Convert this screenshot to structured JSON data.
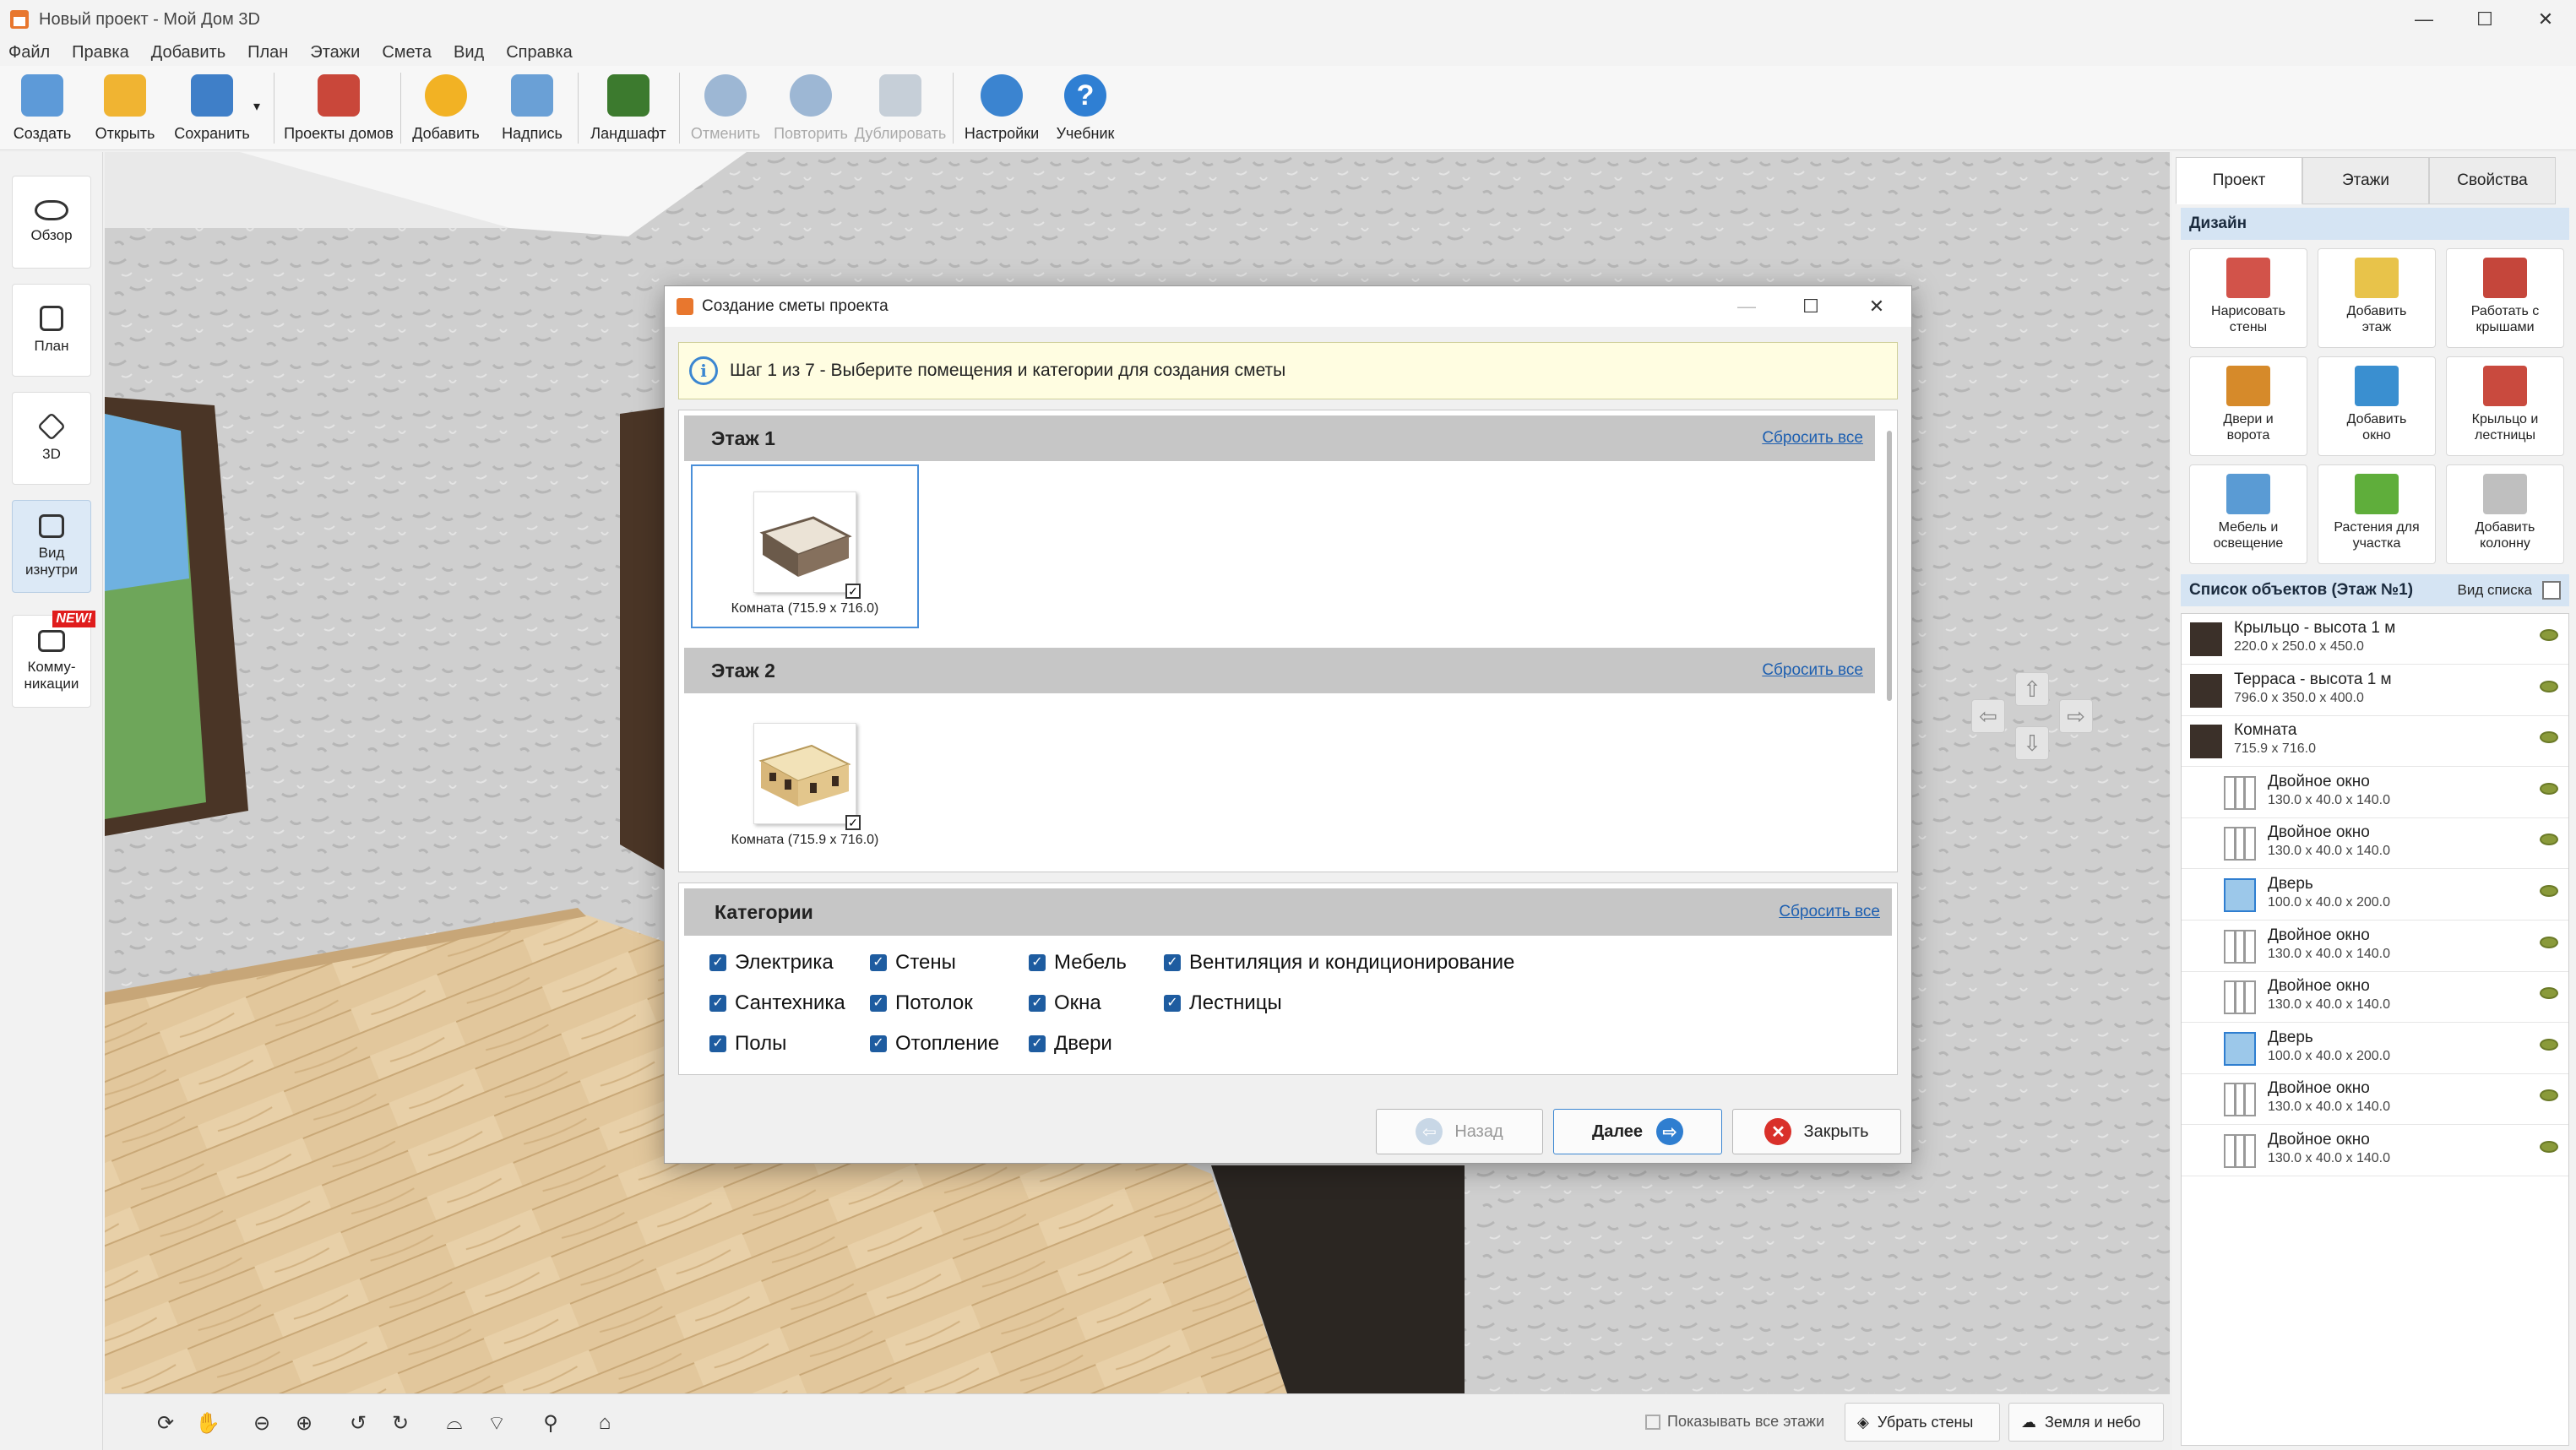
{
  "window": {
    "title": "Новый проект - Мой Дом 3D",
    "min": "—",
    "max": "☐",
    "close": "✕"
  },
  "menu": [
    "Файл",
    "Правка",
    "Добавить",
    "План",
    "Этажи",
    "Смета",
    "Вид",
    "Справка"
  ],
  "toolbar": [
    {
      "label": "Создать",
      "icon": "new-file-icon",
      "color": "#5d9ad8",
      "disabled": false
    },
    {
      "label": "Открыть",
      "icon": "folder-icon",
      "color": "#f0b432",
      "disabled": false
    },
    {
      "label": "Сохранить",
      "icon": "save-icon",
      "color": "#3f7fc8",
      "disabled": false
    },
    {
      "label": "Проекты домов",
      "icon": "house-icon",
      "color": "#c9473a",
      "disabled": false
    },
    {
      "label": "Добавить",
      "icon": "plus-icon",
      "color": "#f2b224",
      "disabled": false
    },
    {
      "label": "Надпись",
      "icon": "paint-icon",
      "color": "#6aa0d6",
      "disabled": false
    },
    {
      "label": "Ландшафт",
      "icon": "tree-icon",
      "color": "#3c7a2e",
      "disabled": false
    },
    {
      "label": "Отменить",
      "icon": "undo-icon",
      "color": "#9db7d4",
      "disabled": true
    },
    {
      "label": "Повторить",
      "icon": "redo-icon",
      "color": "#9db7d4",
      "disabled": true
    },
    {
      "label": "Дублировать",
      "icon": "duplicate-icon",
      "color": "#c6cfd8",
      "disabled": true
    },
    {
      "label": "Настройки",
      "icon": "gear-icon",
      "color": "#3b84d0",
      "disabled": false
    },
    {
      "label": "Учебник",
      "icon": "help-icon",
      "color": "#2f7fd3",
      "disabled": false
    }
  ],
  "left_panel": [
    {
      "label": "Обзор",
      "icon": "eye-icon",
      "active": false,
      "badge": ""
    },
    {
      "label": "План",
      "icon": "plan-icon",
      "active": false,
      "badge": ""
    },
    {
      "label": "3D",
      "icon": "cube-icon",
      "active": false,
      "badge": ""
    },
    {
      "label": "Вид изнутри",
      "icon": "inside-view-icon",
      "active": true,
      "badge": ""
    },
    {
      "label": "Комму-никации",
      "icon": "pipes-icon",
      "active": false,
      "badge": "NEW!"
    }
  ],
  "dialog": {
    "title": "Создание сметы проекта",
    "info": "Шаг 1 из 7 - Выберите помещения и категории для создания сметы",
    "floors": [
      {
        "name": "Этаж 1",
        "reset": "Сбросить все",
        "rooms": [
          {
            "label": "Комната (715.9 x 716.0)",
            "selected": true,
            "checked": "✓"
          }
        ]
      },
      {
        "name": "Этаж 2",
        "reset": "Сбросить все",
        "rooms": [
          {
            "label": "Комната (715.9 x 716.0)",
            "selected": false,
            "checked": "✓"
          }
        ]
      }
    ],
    "categories_title": "Категории",
    "categories_reset": "Сбросить все",
    "categories": [
      [
        "Электрика",
        "Сантехника",
        "Полы"
      ],
      [
        "Стены",
        "Потолок",
        "Отопление"
      ],
      [
        "Мебель",
        "Окна",
        "Двери"
      ],
      [
        "Вентиляция и кондиционирование",
        "Лестницы"
      ]
    ],
    "buttons": {
      "back": "Назад",
      "next": "Далее",
      "close": "Закрыть"
    }
  },
  "right_panel": {
    "tabs": [
      "Проект",
      "Этажи",
      "Свойства"
    ],
    "design_title": "Дизайн",
    "design_buttons": [
      {
        "label": "Нарисовать стены",
        "icon": "brick-wall-icon",
        "color": "#d2534a"
      },
      {
        "label": "Добавить этаж",
        "icon": "add-floor-icon",
        "color": "#e8c34a"
      },
      {
        "label": "Работать с крышами",
        "icon": "roof-icon",
        "color": "#c5463b"
      },
      {
        "label": "Двери и ворота",
        "icon": "door-icon",
        "color": "#d68a2a"
      },
      {
        "label": "Добавить окно",
        "icon": "window-icon",
        "color": "#3a8fd0"
      },
      {
        "label": "Крыльцо и лестницы",
        "icon": "stairs-icon",
        "color": "#c94a3e"
      },
      {
        "label": "Мебель и освещение",
        "icon": "chair-icon",
        "color": "#5a9bd4"
      },
      {
        "label": "Растения для участка",
        "icon": "plant-icon",
        "color": "#5fae3b"
      },
      {
        "label": "Добавить колонну",
        "icon": "column-icon",
        "color": "#bfbfbf"
      }
    ],
    "objects_title": "Список объектов (Этаж №1)",
    "view_list": "Вид списка",
    "objects": [
      {
        "name": "Крыльцо - высота 1 м",
        "dims": "220.0 x 250.0 x 450.0",
        "icon": "porch-icon",
        "indent": false
      },
      {
        "name": "Терраса - высота 1 м",
        "dims": "796.0 x 350.0 x 400.0",
        "icon": "terrace-icon",
        "indent": false
      },
      {
        "name": "Комната",
        "dims": "715.9 x 716.0",
        "icon": "room-icon",
        "indent": false
      },
      {
        "name": "Двойное окно",
        "dims": "130.0 x 40.0 x 140.0",
        "icon": "window-icon",
        "indent": true
      },
      {
        "name": "Двойное окно",
        "dims": "130.0 x 40.0 x 140.0",
        "icon": "window-icon",
        "indent": true
      },
      {
        "name": "Дверь",
        "dims": "100.0 x 40.0 x 200.0",
        "icon": "door-icon",
        "indent": true
      },
      {
        "name": "Двойное окно",
        "dims": "130.0 x 40.0 x 140.0",
        "icon": "window-icon",
        "indent": true
      },
      {
        "name": "Двойное окно",
        "dims": "130.0 x 40.0 x 140.0",
        "icon": "window-icon",
        "indent": true
      },
      {
        "name": "Дверь",
        "dims": "100.0 x 40.0 x 200.0",
        "icon": "door-icon",
        "indent": true
      },
      {
        "name": "Двойное окно",
        "dims": "130.0 x 40.0 x 140.0",
        "icon": "window-icon",
        "indent": true
      },
      {
        "name": "Двойное окно",
        "dims": "130.0 x 40.0 x 140.0",
        "icon": "window-icon",
        "indent": true
      }
    ]
  },
  "bottom_bar": {
    "show_all_floors": "Показывать все этажи",
    "hide_walls": "Убрать стены",
    "ground_sky": "Земля и небо",
    "tools": [
      "rotate-360-icon",
      "hand-icon",
      "zoom-out-icon",
      "zoom-in-icon",
      "rotate-left-icon",
      "rotate-right-icon",
      "tilt-up-icon",
      "tilt-down-icon",
      "light-icon",
      "home-icon"
    ]
  }
}
